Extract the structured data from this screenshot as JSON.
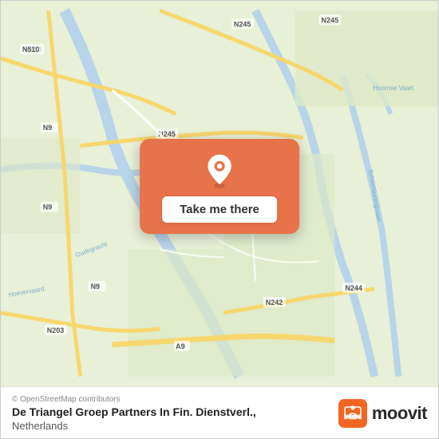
{
  "map": {
    "attribution": "© OpenStreetMap contributors",
    "road_labels": [
      "N510",
      "N245",
      "N9",
      "N245",
      "N242",
      "N244",
      "N203",
      "A9",
      "N9",
      "N9"
    ],
    "popup": {
      "button_label": "Take me there"
    }
  },
  "footer": {
    "attribution": "© OpenStreetMap contributors",
    "location_name": "De Triangel Groep Partners In Fin. Dienstverl.,",
    "location_country": "Netherlands"
  },
  "moovit": {
    "logo_text": "moovit"
  }
}
